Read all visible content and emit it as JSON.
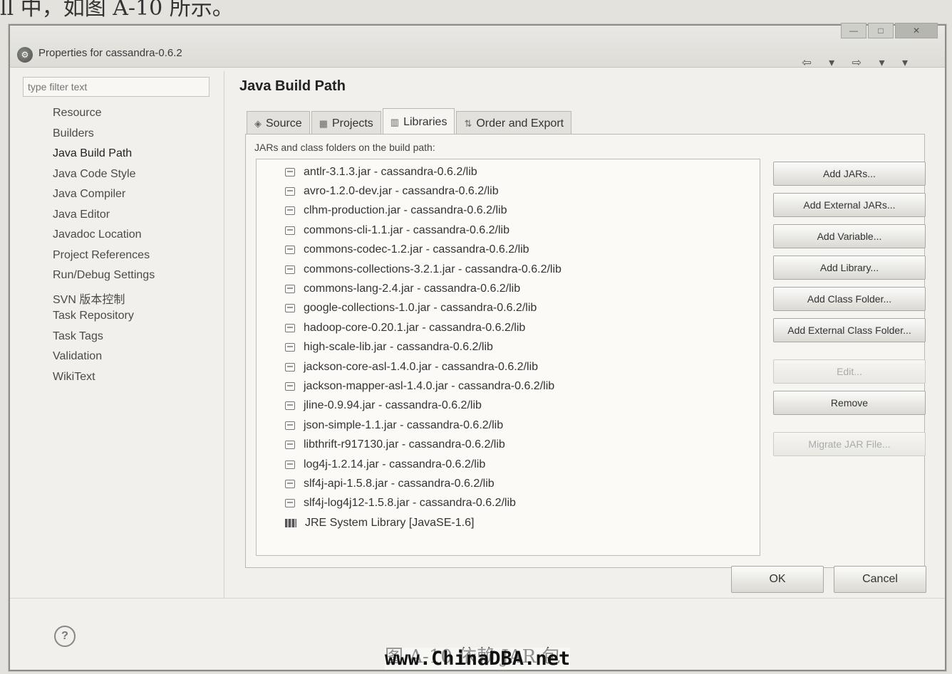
{
  "page": {
    "caption_top": "ll 中，如图 A-10 所示。",
    "caption_bottom": "图 A-10  依赖 JAR 包",
    "watermark": "www.ChinaDBA.net"
  },
  "dialog": {
    "title": "Properties for cassandra-0.6.2",
    "window_buttons": [
      "—",
      "□",
      "✕"
    ]
  },
  "left": {
    "filter_placeholder": "type filter text",
    "items": [
      "Resource",
      "Builders",
      "Java Build Path",
      "Java Code Style",
      "Java Compiler",
      "Java Editor",
      "Javadoc Location",
      "Project References",
      "Run/Debug Settings",
      "SVN 版本控制",
      "Task Repository",
      "Task Tags",
      "Validation",
      "WikiText"
    ],
    "selected_index": 2
  },
  "right": {
    "heading": "Java Build Path",
    "nav_arrows": "⇦ ▾ ⇨ ▾ ▾",
    "tabs": [
      "Source",
      "Projects",
      "Libraries",
      "Order and Export"
    ],
    "selected_tab": 2,
    "list_caption": "JARs and class folders on the build path:",
    "entries": [
      "antlr-3.1.3.jar - cassandra-0.6.2/lib",
      "avro-1.2.0-dev.jar - cassandra-0.6.2/lib",
      "clhm-production.jar - cassandra-0.6.2/lib",
      "commons-cli-1.1.jar - cassandra-0.6.2/lib",
      "commons-codec-1.2.jar - cassandra-0.6.2/lib",
      "commons-collections-3.2.1.jar - cassandra-0.6.2/lib",
      "commons-lang-2.4.jar - cassandra-0.6.2/lib",
      "google-collections-1.0.jar - cassandra-0.6.2/lib",
      "hadoop-core-0.20.1.jar - cassandra-0.6.2/lib",
      "high-scale-lib.jar - cassandra-0.6.2/lib",
      "jackson-core-asl-1.4.0.jar - cassandra-0.6.2/lib",
      "jackson-mapper-asl-1.4.0.jar - cassandra-0.6.2/lib",
      "jline-0.9.94.jar - cassandra-0.6.2/lib",
      "json-simple-1.1.jar - cassandra-0.6.2/lib",
      "libthrift-r917130.jar - cassandra-0.6.2/lib",
      "log4j-1.2.14.jar - cassandra-0.6.2/lib",
      "slf4j-api-1.5.8.jar - cassandra-0.6.2/lib",
      "slf4j-log4j12-1.5.8.jar - cassandra-0.6.2/lib"
    ],
    "jre_entry": "JRE System Library [JavaSE-1.6]",
    "buttons": {
      "add_jars": "Add JARs...",
      "add_external_jars": "Add External JARs...",
      "add_variable": "Add Variable...",
      "add_library": "Add Library...",
      "add_class_folder": "Add Class Folder...",
      "add_external_class_folder": "Add External Class Folder...",
      "edit": "Edit...",
      "remove": "Remove",
      "migrate": "Migrate JAR File..."
    }
  },
  "footer": {
    "help": "?",
    "ok": "OK",
    "cancel": "Cancel"
  }
}
